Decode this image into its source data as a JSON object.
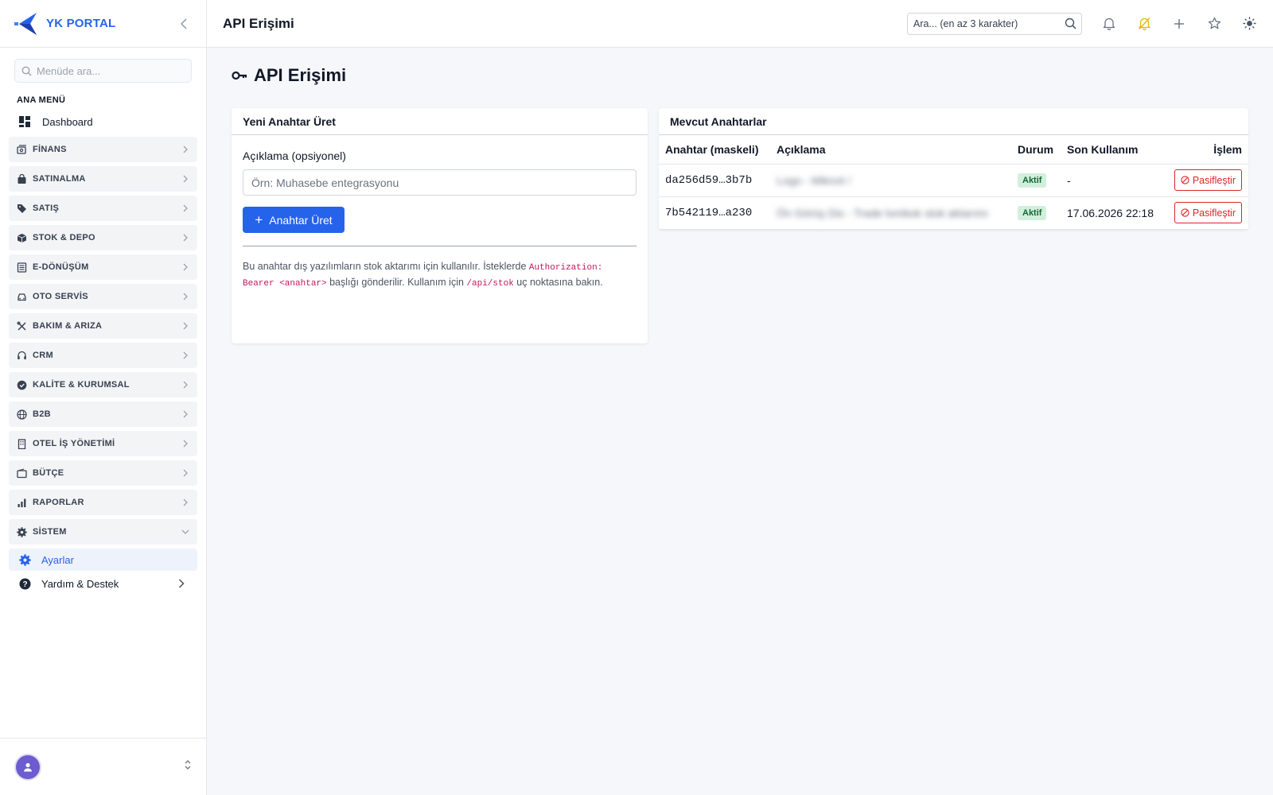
{
  "brand": {
    "name": "YK PORTAL"
  },
  "sidebar": {
    "search_placeholder": "Menüde ara...",
    "section_title": "ANA MENÜ",
    "dashboard_label": "Dashboard",
    "groups": [
      {
        "label": "FİNANS",
        "icon": "finance-icon"
      },
      {
        "label": "SATINALMA",
        "icon": "shopping-bag-icon"
      },
      {
        "label": "SATIŞ",
        "icon": "tag-icon"
      },
      {
        "label": "STOK & DEPO",
        "icon": "box-icon"
      },
      {
        "label": "E-DÖNÜŞÜM",
        "icon": "document-icon"
      },
      {
        "label": "OTO SERVİS",
        "icon": "car-icon"
      },
      {
        "label": "BAKIM & ARIZA",
        "icon": "tools-icon"
      },
      {
        "label": "CRM",
        "icon": "headset-icon"
      },
      {
        "label": "KALİTE & KURUMSAL",
        "icon": "badge-check-icon"
      },
      {
        "label": "B2B",
        "icon": "globe-icon"
      },
      {
        "label": "OTEL İŞ YÖNETİMİ",
        "icon": "building-icon"
      },
      {
        "label": "BÜTÇE",
        "icon": "wallet-icon"
      },
      {
        "label": "RAPORLAR",
        "icon": "bar-chart-icon"
      },
      {
        "label": "SİSTEM",
        "icon": "gear-icon"
      }
    ],
    "sub_active": "Ayarlar",
    "help": "Yardım & Destek"
  },
  "topbar": {
    "title": "API Erişimi",
    "search_placeholder": "Ara... (en az 3 karakter)"
  },
  "page": {
    "title": "API Erişimi"
  },
  "new_key": {
    "title": "Yeni Anahtar Üret",
    "label": "Açıklama (opsiyonel)",
    "placeholder": "Örn: Muhasebe entegrasyonu",
    "button": "Anahtar Üret",
    "note_1": "Bu anahtar dış yazılımların stok aktarımı için kullanılır. İsteklerde ",
    "note_code_1": "Authorization: Bearer <anahtar>",
    "note_2": " başlığı gönderilir. Kullanım için ",
    "note_code_2": "/api/stok",
    "note_3": " uç noktasına bakın."
  },
  "keys": {
    "title": "Mevcut Anahtarlar",
    "headers": [
      "Anahtar (maskeli)",
      "Açıklama",
      "Durum",
      "Son Kullanım",
      "İşlem"
    ],
    "rows": [
      {
        "key": "da256d59…3b7b",
        "desc": "Logo - Mikro4 /",
        "status": "Aktif",
        "last_used": "-",
        "action": "Pasifleştir"
      },
      {
        "key": "7b542119…a230",
        "desc": "Ön Görüş Dis - Trade lombok stok aktarımı",
        "status": "Aktif",
        "last_used": "17.06.2026 22:18",
        "action": "Pasifleştir"
      }
    ]
  },
  "colors": {
    "accent": "#2563eb",
    "danger": "#dc2626",
    "success_bg": "#d1f0dc"
  }
}
